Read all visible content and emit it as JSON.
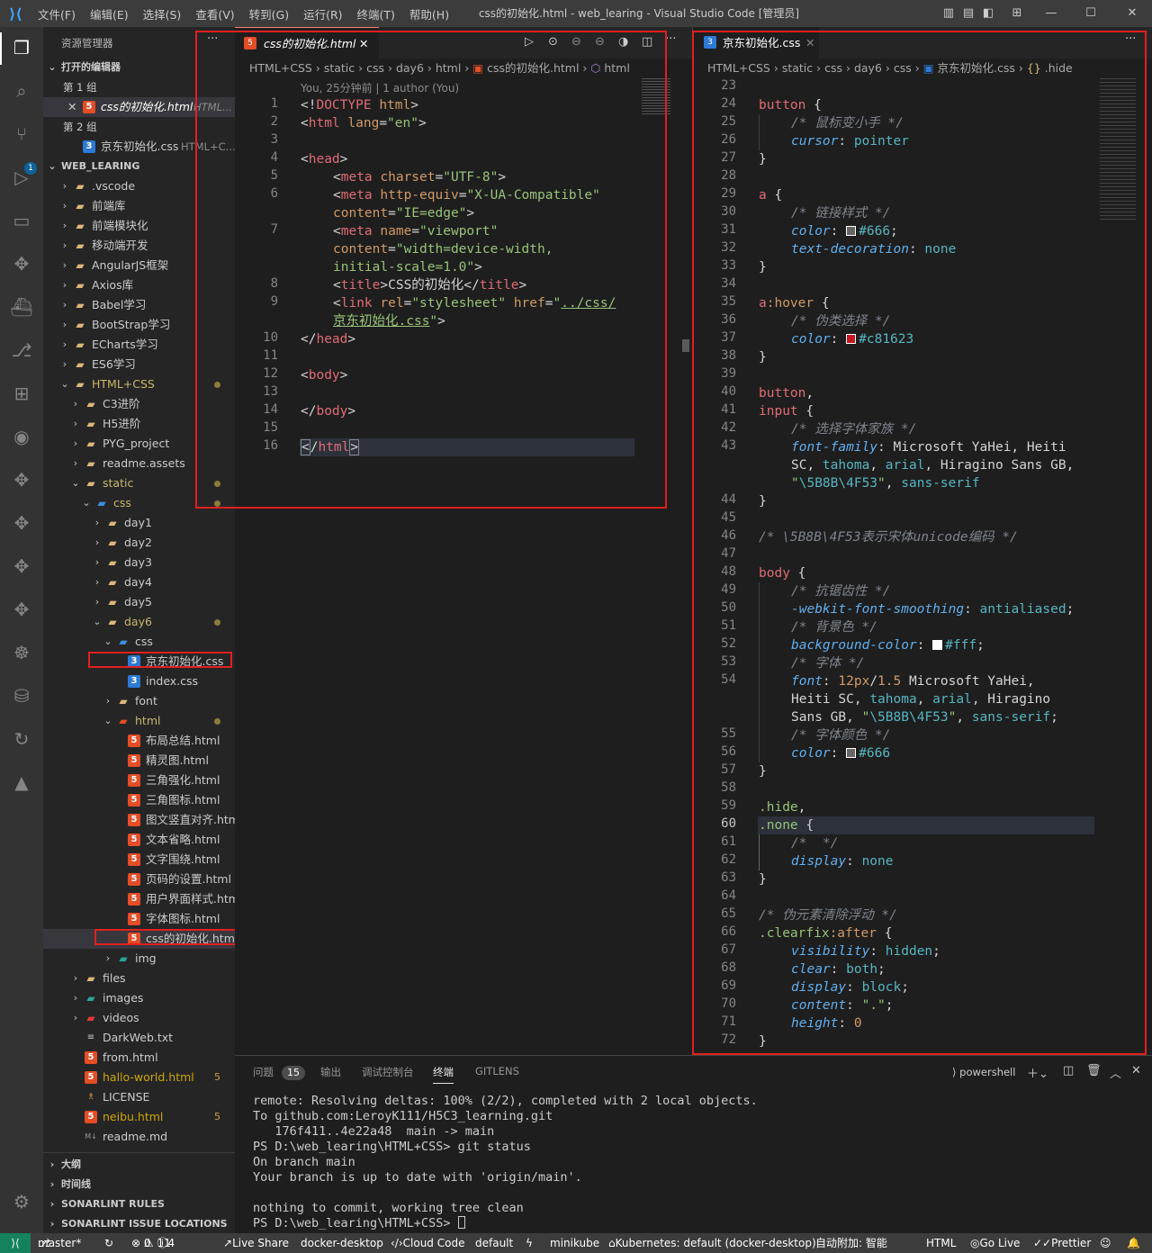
{
  "window": {
    "title": "css的初始化.html - web_learing - Visual Studio Code [管理员]",
    "menu": [
      "文件(F)",
      "编辑(E)",
      "选择(S)",
      "查看(V)",
      "转到(G)",
      "运行(R)",
      "终端(T)",
      "帮助(H)"
    ]
  },
  "sidebar": {
    "title": "资源管理器",
    "open_editors_label": "打开的编辑器",
    "group1_label": "第 1 组",
    "group1_file": "css的初始化.html",
    "group1_file_hint": "HTML...",
    "group2_label": "第 2 组",
    "group2_file": "京东初始化.css",
    "group2_file_hint": "HTML+C...",
    "workspace_label": "WEB_LEARING",
    "tree": [
      {
        "label": ".vscode",
        "depth": 0,
        "kind": "folder",
        "open": false
      },
      {
        "label": "前端库",
        "depth": 0,
        "kind": "folder",
        "open": false
      },
      {
        "label": "前端模块化",
        "depth": 0,
        "kind": "folder",
        "open": false
      },
      {
        "label": "移动端开发",
        "depth": 0,
        "kind": "folder",
        "open": false
      },
      {
        "label": "AngularJS框架",
        "depth": 0,
        "kind": "folder",
        "open": false
      },
      {
        "label": "Axios库",
        "depth": 0,
        "kind": "folder",
        "open": false
      },
      {
        "label": "Babel学习",
        "depth": 0,
        "kind": "folder",
        "open": false
      },
      {
        "label": "BootStrap学习",
        "depth": 0,
        "kind": "folder",
        "open": false
      },
      {
        "label": "ECharts学习",
        "depth": 0,
        "kind": "folder",
        "open": false
      },
      {
        "label": "ES6学习",
        "depth": 0,
        "kind": "folder",
        "open": false
      },
      {
        "label": "HTML+CSS",
        "depth": 0,
        "kind": "folder",
        "open": true,
        "mod": true
      },
      {
        "label": "C3进阶",
        "depth": 1,
        "kind": "folder",
        "open": false
      },
      {
        "label": "H5进阶",
        "depth": 1,
        "kind": "folder",
        "open": false
      },
      {
        "label": "PYG_project",
        "depth": 1,
        "kind": "folder",
        "open": false
      },
      {
        "label": "readme.assets",
        "depth": 1,
        "kind": "folder",
        "open": false
      },
      {
        "label": "static",
        "depth": 1,
        "kind": "folder",
        "open": true,
        "mod": true
      },
      {
        "label": "css",
        "depth": 2,
        "kind": "cssfolder",
        "open": true,
        "mod": true
      },
      {
        "label": "day1",
        "depth": 3,
        "kind": "folder",
        "open": false
      },
      {
        "label": "day2",
        "depth": 3,
        "kind": "folder",
        "open": false
      },
      {
        "label": "day3",
        "depth": 3,
        "kind": "folder",
        "open": false
      },
      {
        "label": "day4",
        "depth": 3,
        "kind": "folder",
        "open": false
      },
      {
        "label": "day5",
        "depth": 3,
        "kind": "folder",
        "open": false
      },
      {
        "label": "day6",
        "depth": 3,
        "kind": "folder",
        "open": true,
        "mod": true
      },
      {
        "label": "css",
        "depth": 4,
        "kind": "cssfolder",
        "open": true
      },
      {
        "label": "京东初始化.css",
        "depth": 5,
        "kind": "css"
      },
      {
        "label": "index.css",
        "depth": 5,
        "kind": "css"
      },
      {
        "label": "font",
        "depth": 4,
        "kind": "folder",
        "open": false
      },
      {
        "label": "html",
        "depth": 4,
        "kind": "htmlfolder",
        "open": true,
        "mod": true
      },
      {
        "label": "布局总结.html",
        "depth": 5,
        "kind": "html"
      },
      {
        "label": "精灵图.html",
        "depth": 5,
        "kind": "html"
      },
      {
        "label": "三角强化.html",
        "depth": 5,
        "kind": "html"
      },
      {
        "label": "三角图标.html",
        "depth": 5,
        "kind": "html"
      },
      {
        "label": "图文竖直对齐.html",
        "depth": 5,
        "kind": "html"
      },
      {
        "label": "文本省略.html",
        "depth": 5,
        "kind": "html"
      },
      {
        "label": "文字围绕.html",
        "depth": 5,
        "kind": "html"
      },
      {
        "label": "页码的设置.html",
        "depth": 5,
        "kind": "html"
      },
      {
        "label": "用户界面样式.html",
        "depth": 5,
        "kind": "html"
      },
      {
        "label": "字体图标.html",
        "depth": 5,
        "kind": "html"
      },
      {
        "label": "css的初始化.html",
        "depth": 5,
        "kind": "html",
        "selected": true
      },
      {
        "label": "img",
        "depth": 4,
        "kind": "imgfolder",
        "open": false
      },
      {
        "label": "files",
        "depth": 1,
        "kind": "folder",
        "open": false
      },
      {
        "label": "images",
        "depth": 1,
        "kind": "imgfolder",
        "open": false
      },
      {
        "label": "videos",
        "depth": 1,
        "kind": "vidfolder",
        "open": false
      },
      {
        "label": "DarkWeb.txt",
        "depth": 1,
        "kind": "txt"
      },
      {
        "label": "from.html",
        "depth": 1,
        "kind": "html"
      },
      {
        "label": "hallo-world.html",
        "depth": 1,
        "kind": "html",
        "warn": true,
        "count": "5"
      },
      {
        "label": "LICENSE",
        "depth": 1,
        "kind": "license"
      },
      {
        "label": "neibu.html",
        "depth": 1,
        "kind": "html",
        "warn": true,
        "count": "5"
      },
      {
        "label": "readme.md",
        "depth": 1,
        "kind": "md"
      }
    ],
    "bottom_sections": [
      "大纲",
      "时间线",
      "SONARLINT RULES",
      "SONARLINT ISSUE LOCATIONS"
    ]
  },
  "editor_left": {
    "tab_label": "css的初始化.html",
    "breadcrumb": [
      "HTML+CSS",
      "static",
      "css",
      "day6",
      "html",
      "css的初始化.html",
      "html"
    ],
    "blame": "You, 25分钟前 | 1 author (You)"
  },
  "editor_right": {
    "tab_label": "京东初始化.css",
    "breadcrumb": [
      "HTML+CSS",
      "static",
      "css",
      "day6",
      "css",
      "京东初始化.css",
      ".hide"
    ]
  },
  "panel": {
    "tabs": [
      "问题",
      "输出",
      "调试控制台",
      "终端",
      "GITLENS"
    ],
    "problems_count": "15",
    "active_tab": "终端",
    "shell_label": "powershell",
    "terminal_lines": [
      "remote: Resolving deltas: 100% (2/2), completed with 2 local objects.",
      "To github.com:LeroyK111/H5C3_learning.git",
      "   176f411..4e22a48  main -> main",
      "PS D:\\web_learing\\HTML+CSS> git status",
      "On branch main",
      "Your branch is up to date with 'origin/main'.",
      "",
      "nothing to commit, working tree clean",
      "PS D:\\web_learing\\HTML+CSS> "
    ]
  },
  "statusbar": {
    "branch": "master*",
    "errors": "0",
    "warnings": "11",
    "info": "4",
    "live_share": "Live Share",
    "docker": "docker-desktop",
    "cloud_code": "Cloud Code",
    "default": "default",
    "minikube": "minikube",
    "kubernetes": "Kubernetes: default (docker-desktop)",
    "auto_attach": "自动附加: 智能",
    "language": "HTML",
    "go_live": "Go Live",
    "prettier": "Prettier"
  },
  "colors": {
    "highlight_red": "#e02020",
    "css_color_666": "#666",
    "css_color_c81623": "#c81623",
    "css_color_fff": "#fff"
  }
}
